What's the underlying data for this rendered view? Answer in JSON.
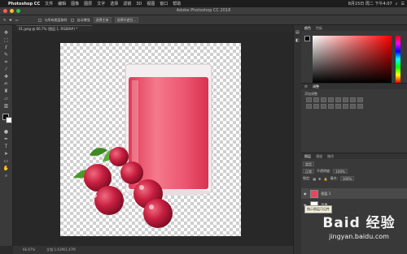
{
  "menubar": {
    "app_name": "Photoshop CC",
    "items": [
      "文件",
      "编辑",
      "图像",
      "图层",
      "文字",
      "选择",
      "滤镜",
      "3D",
      "视图",
      "窗口",
      "帮助"
    ],
    "clock": "8月15日 周二 下午4:07"
  },
  "window": {
    "title": "Adobe Photoshop CC 2018"
  },
  "options": {
    "auto_enhance": "与所有图层取样",
    "auto_enhance2": "自动增强",
    "select_subject": "选择主体",
    "select_mask": "选择并遮住..."
  },
  "document": {
    "tab_label": "01.jpeg @ 66.7% (图层 1, RGB/8#) *",
    "zoom": "66.67%",
    "doc_size": "文档:1.61M/1.47M"
  },
  "panels": {
    "color_tab": "颜色",
    "swatches_tab": "色板",
    "library_tab": "库",
    "adjust_tab": "调整",
    "adjust_label": "添加调整",
    "layers_tab": "图层",
    "channels_tab": "通道",
    "paths_tab": "路径",
    "kind_label": "类型",
    "blend_mode": "正常",
    "opacity_label": "不透明度:",
    "opacity": "100%",
    "lock_label": "锁定:",
    "fill_label": "填充:",
    "fill": "100%",
    "layers": [
      {
        "name": "图层 1"
      },
      {
        "name": "背景"
      }
    ]
  },
  "tooltip": "指示图层可见性",
  "watermark": {
    "line1": "Baid 经验",
    "line2": "jingyan.baidu.com"
  },
  "colors": {
    "juice": "#e84660",
    "berry": "#c41c3c",
    "leaf": "#4a9a2a"
  },
  "icons": [
    "apple-icon",
    "move-tool-icon",
    "marquee-tool-icon",
    "lasso-tool-icon",
    "quick-select-icon",
    "crop-icon",
    "eyedropper-icon",
    "healing-icon",
    "brush-icon",
    "stamp-icon",
    "history-brush-icon",
    "eraser-icon",
    "gradient-icon",
    "blur-icon",
    "dodge-icon",
    "pen-icon",
    "type-icon",
    "path-select-icon",
    "shape-icon",
    "hand-icon",
    "zoom-icon",
    "eye-icon"
  ]
}
